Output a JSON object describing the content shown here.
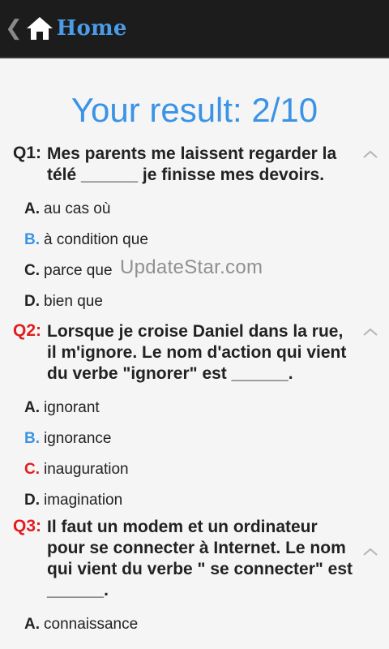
{
  "actionbar": {
    "title": "Home",
    "caret_glyph": "❮",
    "home_icon": "home-icon",
    "title_color": "#4a9be8"
  },
  "result": {
    "text": "Your result: 2/10",
    "color": "#3a93e5"
  },
  "colors": {
    "correct": "#3a93e5",
    "wrong": "#e21d1d"
  },
  "questions": [
    {
      "label": "Q1:",
      "status": "correct",
      "text": "Mes parents me laissent regarder la télé ______ je finisse mes devoirs.",
      "answers": [
        {
          "letter": "A.",
          "text": "au cas où",
          "state": "none"
        },
        {
          "letter": "B.",
          "text": "à condition que",
          "state": "correct"
        },
        {
          "letter": "C.",
          "text": "parce que",
          "state": "none"
        },
        {
          "letter": "D.",
          "text": "bien que",
          "state": "none"
        }
      ]
    },
    {
      "label": "Q2:",
      "status": "wrong",
      "text": "Lorsque je croise Daniel dans la rue, il m'ignore. Le nom d'action qui vient du verbe \"ignorer\" est ______.",
      "answers": [
        {
          "letter": "A.",
          "text": "ignorant",
          "state": "none"
        },
        {
          "letter": "B.",
          "text": "ignorance",
          "state": "correct"
        },
        {
          "letter": "C.",
          "text": "inauguration",
          "state": "wrong"
        },
        {
          "letter": "D.",
          "text": "imagination",
          "state": "none"
        }
      ]
    },
    {
      "label": "Q3:",
      "status": "wrong",
      "text": "Il faut un modem et un ordinateur pour se connecter à Internet. Le nom qui vient du verbe \" se connecter\" est ______.",
      "answers": [
        {
          "letter": "A.",
          "text": "connaissance",
          "state": "none"
        }
      ]
    }
  ],
  "watermark": "UpdateStar.com"
}
